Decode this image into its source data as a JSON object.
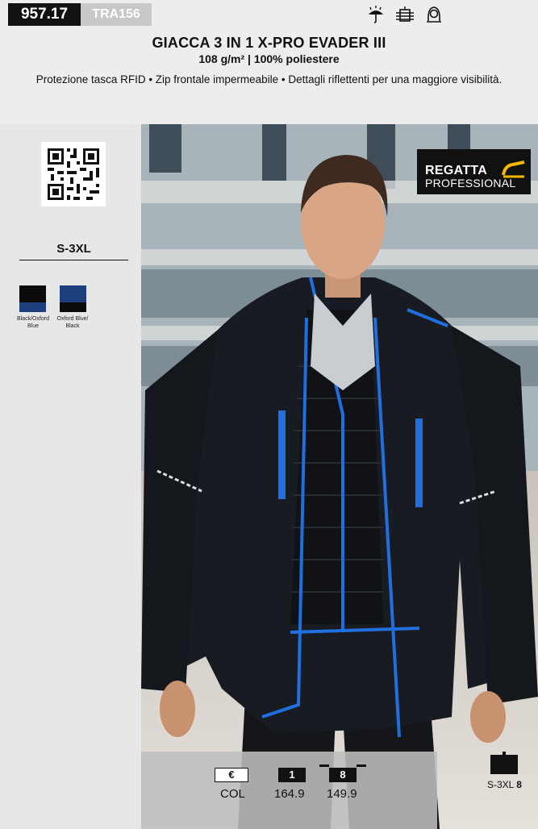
{
  "header": {
    "code": "957.17",
    "ref": "TRA156",
    "care_icons": [
      "umbrella-icon",
      "windproof-icon",
      "hood-icon"
    ]
  },
  "product": {
    "title": "GIACCA 3 IN 1 X-PRO EVADER III",
    "subtitle": "108 g/m² | 100% poliestere",
    "features": "Protezione tasca RFID • Zip frontale impermeabile • Dettagli riflettenti per una maggiore visibilità."
  },
  "sidebar": {
    "sizes": "S-3XL",
    "colors": [
      {
        "label": "Black/Oxford Blue",
        "top": "#0b0b0b",
        "bottom": "#1d3f7d"
      },
      {
        "label": "Oxford Blue/ Black",
        "top": "#1d3f7d",
        "bottom": "#0b0b0b"
      }
    ]
  },
  "brand": {
    "line1": "REGATTA",
    "line2": "PROFESSIONAL"
  },
  "pricing": {
    "currency": "€",
    "col_label": "COL",
    "tiers": [
      {
        "qty": "1",
        "price": "164.9"
      },
      {
        "qty": "8",
        "price": "149.9"
      }
    ]
  },
  "packaging": {
    "size_range": "S-3XL",
    "qty": "8"
  }
}
